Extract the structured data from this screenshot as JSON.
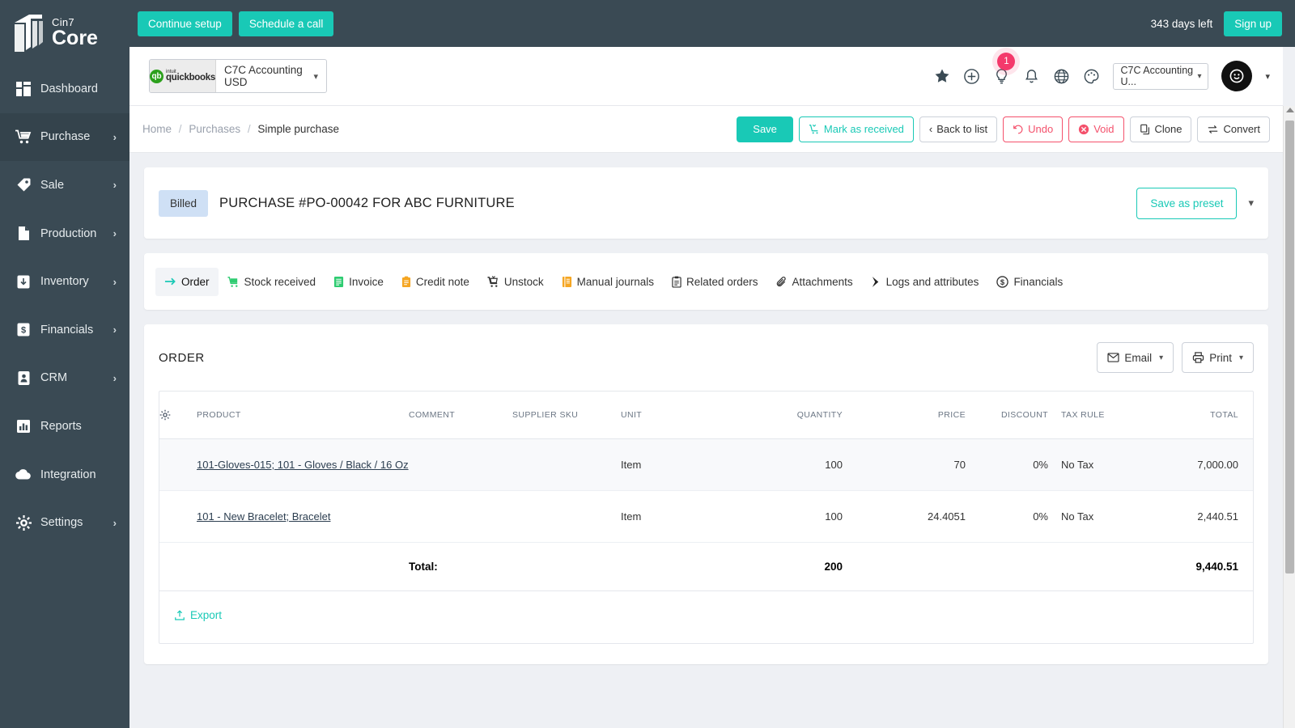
{
  "brand": {
    "name_small": "Cin7",
    "name_big": "Core"
  },
  "topbar": {
    "continue_setup": "Continue setup",
    "schedule_call": "Schedule a call",
    "days_left": "343 days left",
    "sign_up": "Sign up"
  },
  "sidebar": {
    "items": [
      {
        "label": "Dashboard",
        "icon": "dashboard-icon",
        "chevron": "",
        "active": false
      },
      {
        "label": "Purchase",
        "icon": "cart-icon",
        "chevron": "›",
        "active": true
      },
      {
        "label": "Sale",
        "icon": "tag-icon",
        "chevron": "›",
        "active": false
      },
      {
        "label": "Production",
        "icon": "page-icon",
        "chevron": "›",
        "active": false
      },
      {
        "label": "Inventory",
        "icon": "box-down-icon",
        "chevron": "›",
        "active": false
      },
      {
        "label": "Financials",
        "icon": "dollar-icon",
        "chevron": "›",
        "active": false
      },
      {
        "label": "CRM",
        "icon": "contact-icon",
        "chevron": "›",
        "active": false
      },
      {
        "label": "Reports",
        "icon": "bar-chart-icon",
        "chevron": "",
        "active": false
      },
      {
        "label": "Integration",
        "icon": "cloud-icon",
        "chevron": "",
        "active": false
      },
      {
        "label": "Settings",
        "icon": "gear-icon",
        "chevron": "›",
        "active": false
      }
    ]
  },
  "subbar": {
    "quickbooks_label_small": "intuit",
    "quickbooks_label": "quickbooks",
    "quickbooks_value": "C7C Accounting USD",
    "notification_badge": "1",
    "account_value": "C7C Accounting U...",
    "icons": [
      "star-icon",
      "plus-circle-icon",
      "lightbulb-icon",
      "bell-icon",
      "globe-icon",
      "palette-icon"
    ]
  },
  "breadcrumb": {
    "home": "Home",
    "purchases": "Purchases",
    "current": "Simple purchase"
  },
  "actions": {
    "save": "Save",
    "mark_as_received": "Mark as received",
    "back_to_list": "Back to list",
    "undo": "Undo",
    "void": "Void",
    "clone": "Clone",
    "convert": "Convert"
  },
  "order_header": {
    "status": "Billed",
    "title": "PURCHASE #PO-00042 FOR ABC FURNITURE",
    "save_as_preset": "Save as preset"
  },
  "tabs": [
    {
      "label": "Order",
      "icon": "arrow-right-icon",
      "active": true
    },
    {
      "label": "Stock received",
      "icon": "cart-green-icon",
      "active": false
    },
    {
      "label": "Invoice",
      "icon": "invoice-green-icon",
      "active": false
    },
    {
      "label": "Credit note",
      "icon": "credit-note-orange-icon",
      "active": false
    },
    {
      "label": "Unstock",
      "icon": "cart-dark-icon",
      "active": false
    },
    {
      "label": "Manual journals",
      "icon": "journal-orange-icon",
      "active": false
    },
    {
      "label": "Related orders",
      "icon": "clipboard-icon",
      "active": false
    },
    {
      "label": "Attachments",
      "icon": "paperclip-icon",
      "active": false
    },
    {
      "label": "Logs and attributes",
      "icon": "chevron-solid-icon",
      "active": false
    },
    {
      "label": "Financials",
      "icon": "dollar-circle-icon",
      "active": false
    }
  ],
  "order": {
    "section_title": "ORDER",
    "email_button": "Email",
    "print_button": "Print",
    "export_link": "Export",
    "columns": [
      "PRODUCT",
      "COMMENT",
      "SUPPLIER SKU",
      "UNIT",
      "QUANTITY",
      "PRICE",
      "DISCOUNT",
      "TAX RULE",
      "TOTAL"
    ],
    "rows": [
      {
        "product": "101-Gloves-015; 101 - Gloves / Black / 16 Oz",
        "comment": "",
        "supplier_sku": "",
        "unit": "Item",
        "quantity": "100",
        "price": "70",
        "discount": "0%",
        "tax_rule": "No Tax",
        "total": "7,000.00"
      },
      {
        "product": "101 - New Bracelet; Bracelet",
        "comment": "",
        "supplier_sku": "",
        "unit": "Item",
        "quantity": "100",
        "price": "24.4051",
        "discount": "0%",
        "tax_rule": "No Tax",
        "total": "2,440.51"
      }
    ],
    "totals": {
      "label": "Total:",
      "quantity": "200",
      "total": "9,440.51"
    }
  },
  "colors": {
    "teal": "#19c9b6",
    "sidebar": "#3a4a54",
    "badge_pink": "#f4396b",
    "red": "#f4516c",
    "status_chip": "#cfe0f5"
  }
}
